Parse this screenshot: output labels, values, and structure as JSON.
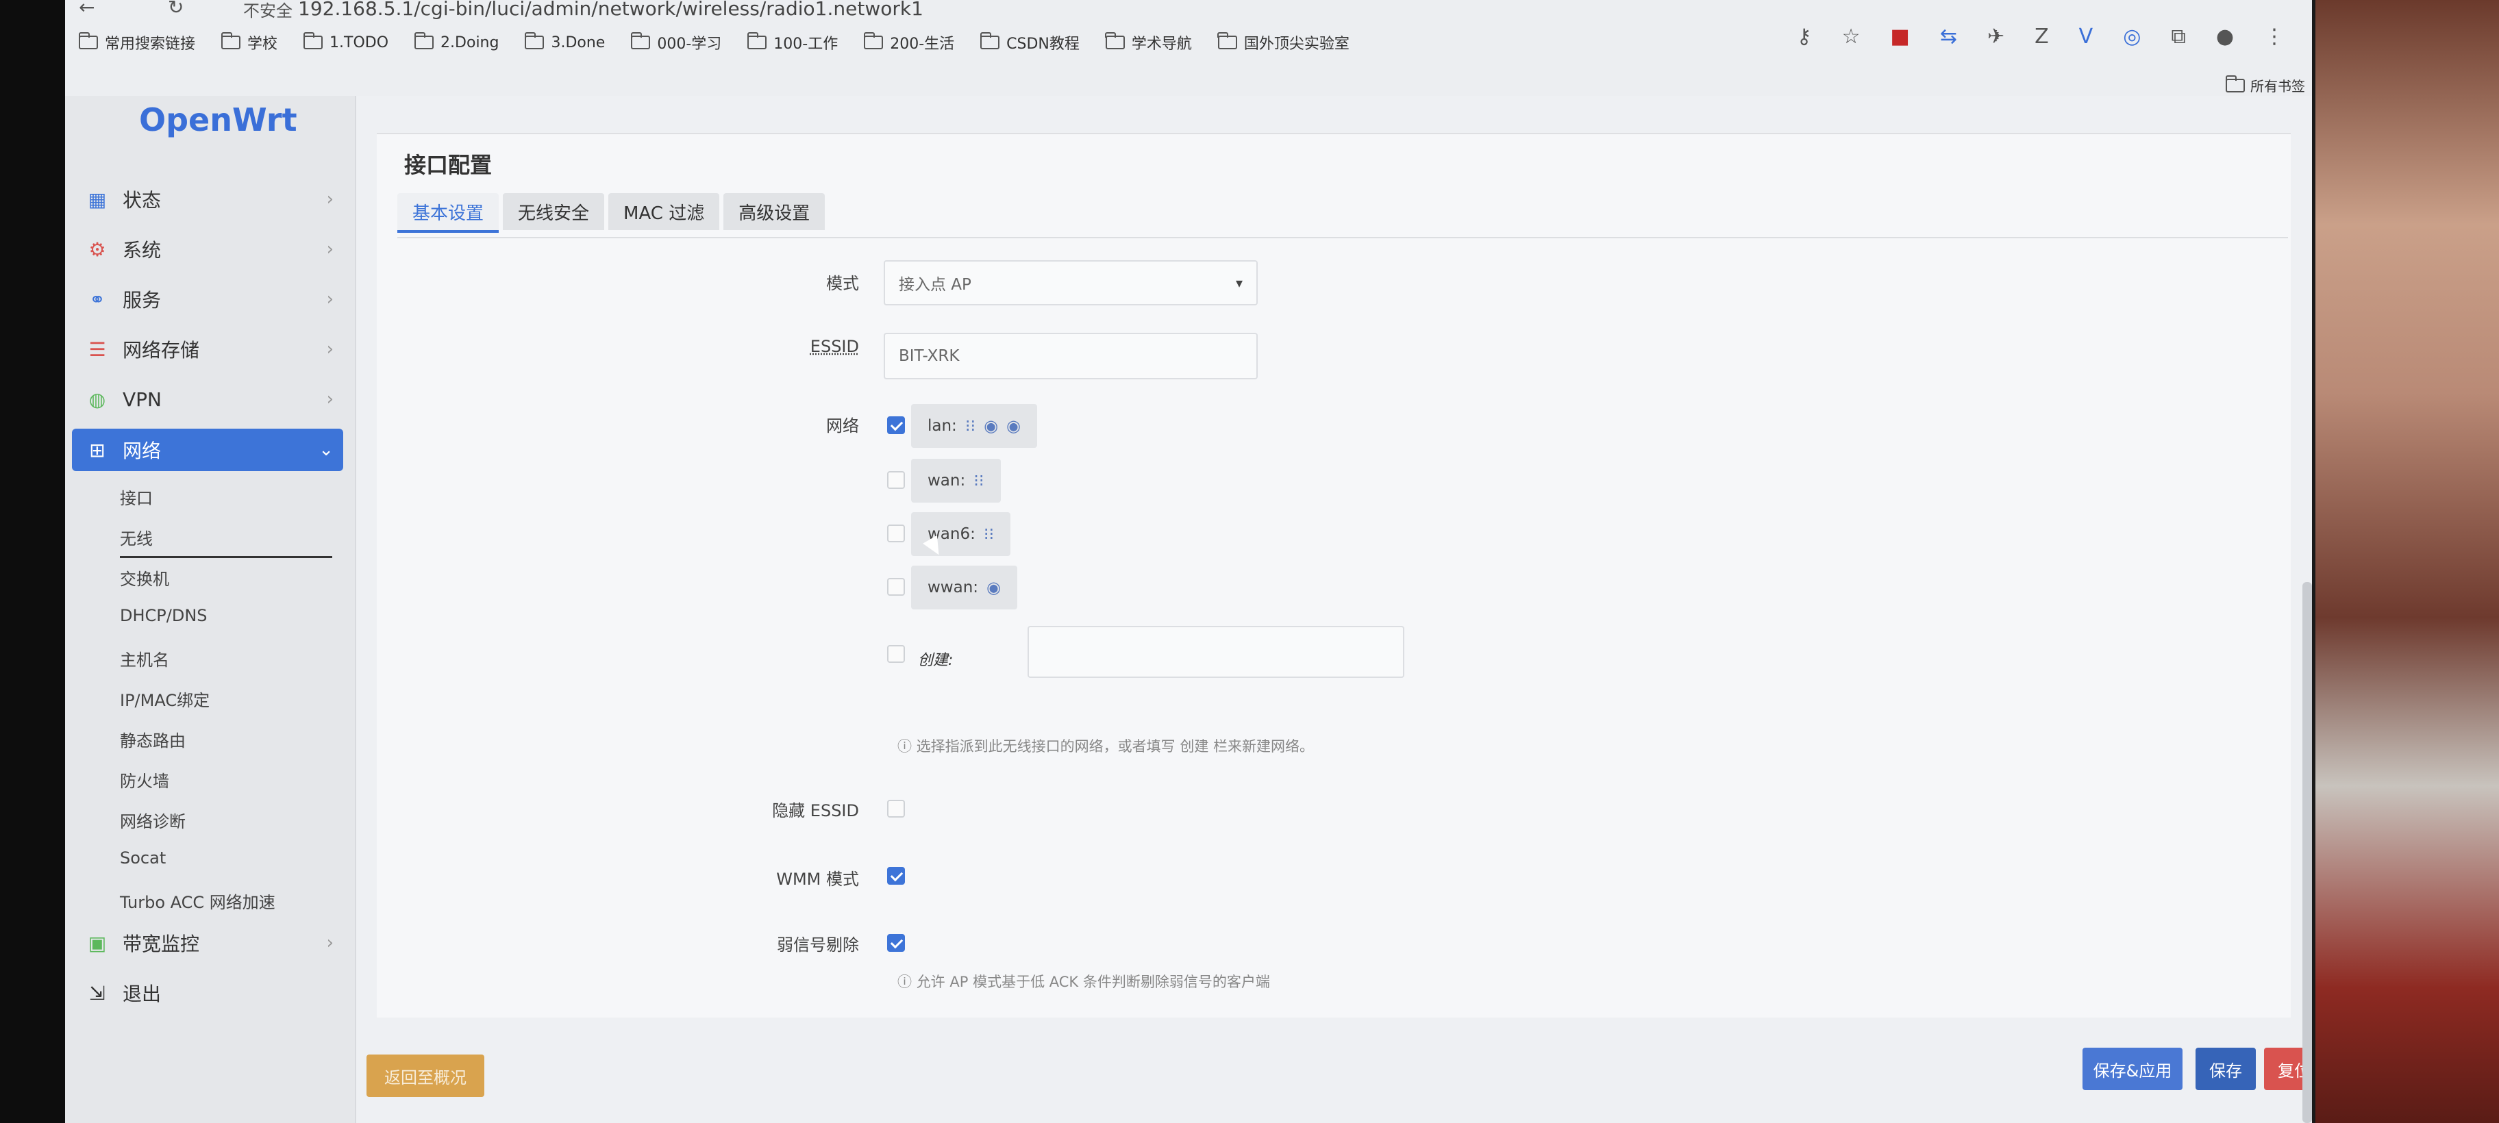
{
  "browser": {
    "security_label": "不安全",
    "url": "192.168.5.1/cgi-bin/luci/admin/network/wireless/radio1.network1",
    "bookmarks": [
      "常用搜索链接",
      "学校",
      "1.TODO",
      "2.Doing",
      "3.Done",
      "000-学习",
      "100-工作",
      "200-生活",
      "CSDN教程",
      "学术导航",
      "国外顶尖实验室"
    ],
    "all_bookmarks": "所有书签"
  },
  "sidebar": {
    "logo": "OpenWrt",
    "items": [
      {
        "label": "状态",
        "icon": "dashboard-icon"
      },
      {
        "label": "系统",
        "icon": "gear-icon"
      },
      {
        "label": "服务",
        "icon": "services-icon"
      },
      {
        "label": "网络存储",
        "icon": "database-icon"
      },
      {
        "label": "VPN",
        "icon": "vpn-icon"
      },
      {
        "label": "网络",
        "icon": "network-icon"
      },
      {
        "label": "带宽监控",
        "icon": "monitor-icon"
      },
      {
        "label": "退出",
        "icon": "logout-icon"
      }
    ],
    "sub_items": [
      "接口",
      "无线",
      "交换机",
      "DHCP/DNS",
      "主机名",
      "IP/MAC绑定",
      "静态路由",
      "防火墙",
      "网络诊断",
      "Socat",
      "Turbo ACC 网络加速"
    ]
  },
  "main": {
    "section_title": "接口配置",
    "tabs": [
      "基本设置",
      "无线安全",
      "MAC 过滤",
      "高级设置"
    ],
    "fields": {
      "mode_label": "模式",
      "mode_value": "接入点 AP",
      "essid_label": "ESSID",
      "essid_value": "BIT-XRK",
      "network_label": "网络",
      "networks": [
        {
          "name": "lan:",
          "checked": true
        },
        {
          "name": "wan:",
          "checked": false
        },
        {
          "name": "wan6:",
          "checked": false
        },
        {
          "name": "wwan:",
          "checked": false
        }
      ],
      "create_label": "创建:",
      "network_hint": "选择指派到此无线接口的网络，或者填写 创建 栏来新建网络。",
      "hide_essid_label": "隐藏 ESSID",
      "wmm_label": "WMM 模式",
      "weak_label": "弱信号剔除",
      "weak_hint": "允许 AP 模式基于低 ACK 条件判断剔除弱信号的客户端"
    },
    "buttons": {
      "back": "返回至概况",
      "save_apply": "保存&应用",
      "save": "保存",
      "reset": "复位"
    }
  }
}
